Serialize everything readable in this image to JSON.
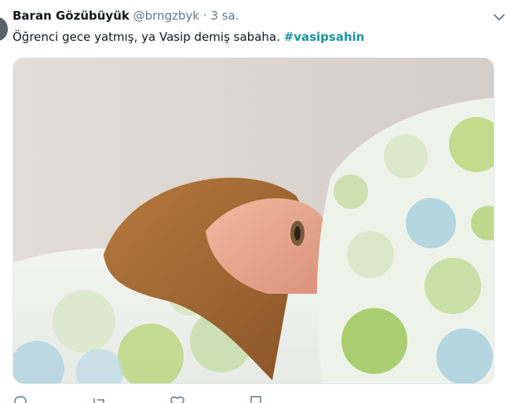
{
  "tweet": {
    "author_name": "Baran Gözübüyük",
    "author_handle": "@brngzbyk",
    "separator": "·",
    "time": "3 sa.",
    "text": "Öğrenci gece yatmış, ya Vasip demiş sabaha.",
    "hashtag": "#vasipsahin"
  },
  "icons": {
    "menu": "chevron-down-icon",
    "reply": "reply-icon",
    "retweet": "retweet-icon",
    "like": "heart-icon",
    "share": "share-icon"
  },
  "colors": {
    "hashtag": "#1b95a0",
    "secondary": "#657786"
  }
}
